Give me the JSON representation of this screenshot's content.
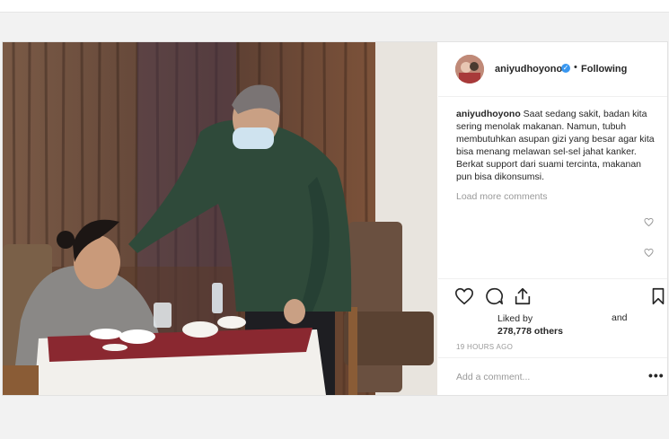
{
  "post": {
    "username": "aniyudhoyono",
    "follow_separator": "•",
    "follow_status": "Following",
    "caption_user": "aniyudhoyono",
    "caption_text": " Saat sedang sakit, badan kita sering menolak makanan. Namun, tubuh membutuhkan asupan gizi yang besar agar kita bisa menang melawan sel-sel jahat kanker. Berkat support dari suami tercinta, makanan pun bisa dikonsumsi.",
    "load_more": "Load more comments",
    "liked_by": "Liked by",
    "likes_count": "278,778 others",
    "and_text": "and",
    "timestamp": "19 HOURS AGO",
    "comment_placeholder": "Add a comment...",
    "more_label": "•••"
  },
  "icons": {
    "verified": "verified-badge-icon",
    "like": "heart-icon",
    "comment": "comment-icon",
    "share": "share-icon",
    "save": "bookmark-icon",
    "comment_like": "heart-icon"
  },
  "colors": {
    "verified_blue": "#3897f0",
    "text": "#262626",
    "muted": "#999999"
  }
}
